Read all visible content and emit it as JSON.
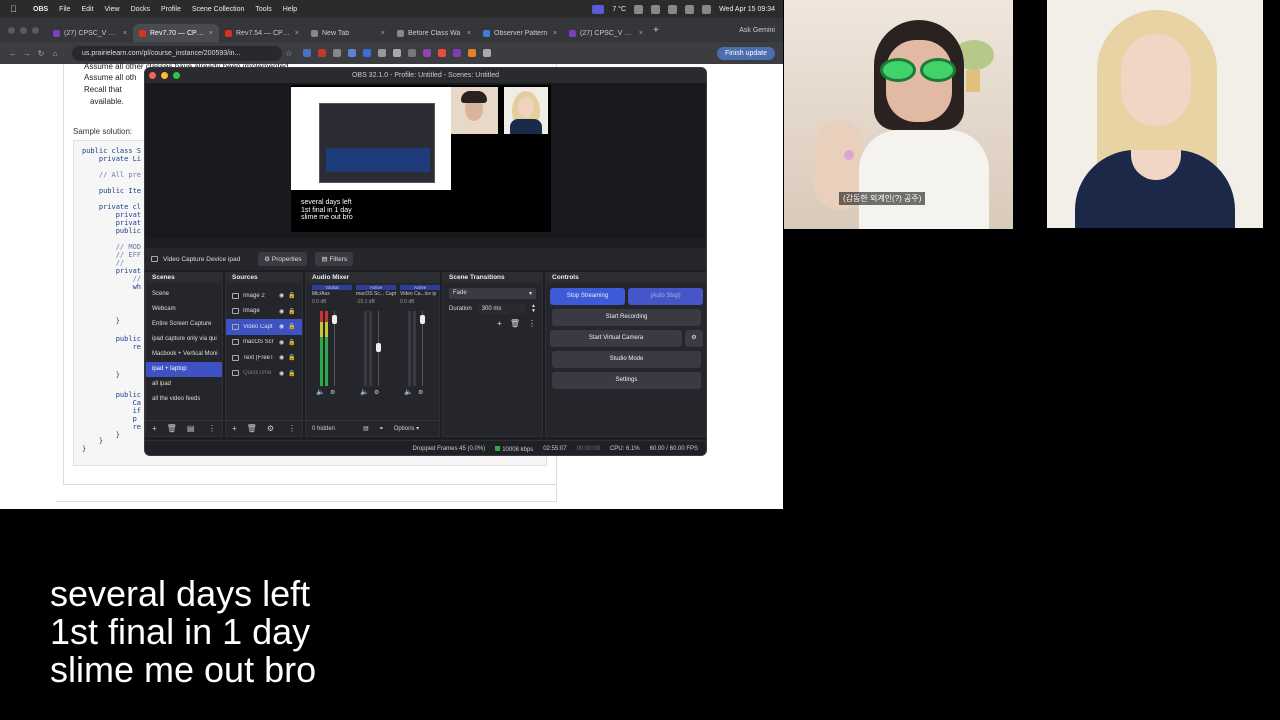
{
  "menubar": {
    "app": "OBS",
    "items": [
      "File",
      "Edit",
      "View",
      "Docks",
      "Profile",
      "Scene Collection",
      "Tools",
      "Help"
    ],
    "temp": "7 °C",
    "datetime": "Wed Apr 15 09:34"
  },
  "browser": {
    "tabs": [
      {
        "label": "(27) CPSC_V 210",
        "color": "#7b3fbf"
      },
      {
        "label": "Rev7.70 — CPSC",
        "color": "#d93025"
      },
      {
        "label": "Rev7.54 — CPSC",
        "color": "#d93025"
      },
      {
        "label": "New Tab",
        "color": "#888888"
      },
      {
        "label": "Before Class Wa",
        "color": "#888888"
      },
      {
        "label": "Observer Pattern",
        "color": "#3c7cdc"
      },
      {
        "label": "(27) CPSC_V 210",
        "color": "#7b3fbf"
      }
    ],
    "ask_gemini": "Ask Gemini",
    "url": "us.prairielearn.com/pl/course_instance/200593/in...",
    "finish_update": "Finish update"
  },
  "webpage": {
    "bullets": [
      "Assume all other classes have already been implemented.",
      "Assume all oth",
      "Recall that",
      "available."
    ],
    "sample_label": "Sample solution:",
    "code_lines": [
      {
        "t": "public class S",
        "cm": false
      },
      {
        "t": "    private Li",
        "cm": false
      },
      {
        "t": "    // All pre",
        "cm": true
      },
      {
        "t": "    public Ite",
        "cm": false
      },
      {
        "t": "    private cl",
        "cm": false
      },
      {
        "t": "        privat",
        "cm": false
      },
      {
        "t": "        privat",
        "cm": false
      },
      {
        "t": "        public",
        "cm": false
      },
      {
        "t": "        // MOD",
        "cm": true
      },
      {
        "t": "        // EFF",
        "cm": true
      },
      {
        "t": "        //",
        "cm": true
      },
      {
        "t": "        privat",
        "cm": false
      },
      {
        "t": "            //",
        "cm": true
      },
      {
        "t": "            wh",
        "cm": false
      },
      {
        "t": "        }",
        "cm": false
      },
      {
        "t": "        public",
        "cm": false
      },
      {
        "t": "            re",
        "cm": false
      },
      {
        "t": "        }",
        "cm": false
      },
      {
        "t": "        public",
        "cm": false
      },
      {
        "t": "            Ca",
        "cm": false
      },
      {
        "t": "            if",
        "cm": false
      },
      {
        "t": "            p",
        "cm": false
      },
      {
        "t": "            re",
        "cm": false
      },
      {
        "t": "        }",
        "cm": false
      },
      {
        "t": "    }",
        "cm": false
      },
      {
        "t": "}",
        "cm": false
      }
    ]
  },
  "obs": {
    "title": "OBS 32.1.0 - Profile: Untitled - Scenes: Untitled",
    "canvas_text": "several days left\n1st final in 1 day\nslime me out bro",
    "source_selected": "Video Capture Device ipad",
    "properties": "Properties",
    "filters": "Filters",
    "scenes_header": "Scenes",
    "scenes": [
      "Scene",
      "Webcam",
      "Entire Screen Capture",
      "ipad capture only via qui",
      "Macbook + Vertical Moni",
      "ipad + laptop",
      "all ipad",
      "all the video feeds"
    ],
    "scene_selected_index": 5,
    "sources_header": "Sources",
    "sources": [
      "Image 2",
      "Image",
      "Video Capt",
      "macOS Scr",
      "Text (FreeT",
      "QuickTime"
    ],
    "source_selected_index": 2,
    "mixer_header": "Audio Mixer",
    "mixer_channels": [
      {
        "name": "Mic/Aux",
        "tag": "Global",
        "db": "0.0 dB",
        "fader": 0.95
      },
      {
        "name": "macOS Sc... Capture",
        "tag": "Active",
        "db": "-15.1 dB",
        "fader": 0.55
      },
      {
        "name": "Video Ca...ice ip",
        "tag": "Active",
        "db": "0.0 dB",
        "fader": 0.95
      }
    ],
    "hidden_count": "0 hidden",
    "options": "Options",
    "transitions_header": "Scene Transitions",
    "transition": "Fade",
    "duration_label": "Duration",
    "duration_value": "300 ms",
    "controls_header": "Controls",
    "stop_streaming": "Stop Streaming",
    "auto_stop": "(Auto Stop)",
    "start_recording": "Start Recording",
    "start_virtual_camera": "Start Virtual Camera",
    "studio_mode": "Studio Mode",
    "settings": "Settings",
    "status": {
      "dropped": "Dropped Frames 45 (0.0%)",
      "kbps": "10008 kbps",
      "stream_time": "02:55:07",
      "rec_time": "00:00:00",
      "cpu": "CPU: 6.1%",
      "fps": "60.00 / 60.00 FPS"
    }
  },
  "webcam1_caption": "(감동한 외계인(?) 공주)",
  "overlay_lines": [
    "several days left",
    "1st final in 1 day",
    "slime me out bro"
  ]
}
